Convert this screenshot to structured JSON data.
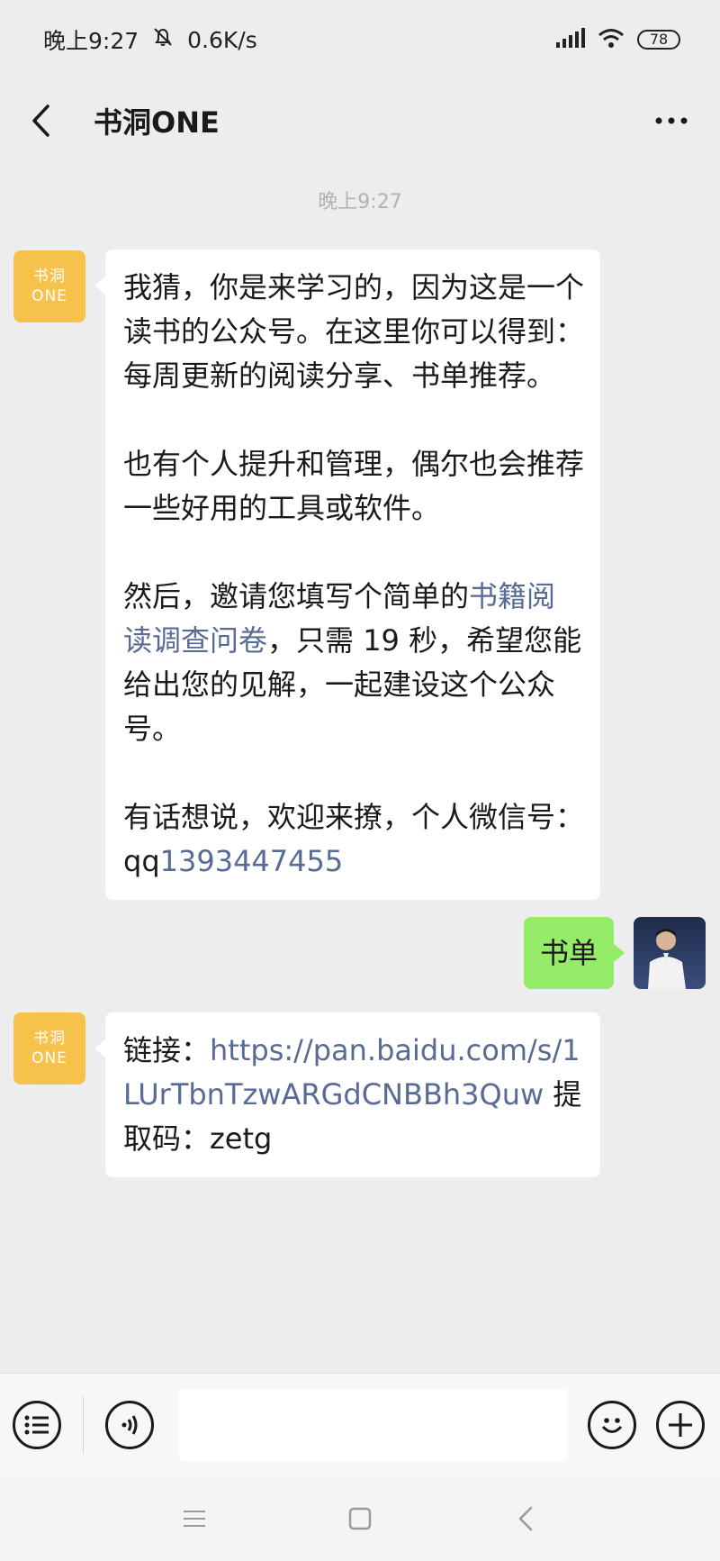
{
  "status_bar": {
    "time": "晚上9:27",
    "net_speed": "0.6K/s",
    "battery": "78",
    "icons": [
      "mute-bell-icon",
      "signal-icon",
      "wifi-icon",
      "battery-icon"
    ]
  },
  "header": {
    "title": "书洞ONE",
    "icons": [
      "back-arrow-icon",
      "more-icon"
    ]
  },
  "chat": {
    "timestamp": "晚上9:27",
    "bot_avatar_line1": "书洞",
    "bot_avatar_line2": "ONE",
    "message1": {
      "p1": "我猜，你是来学习的，因为这是一个读书的公众号。在这里你可以得到：每周更新的阅读分享、书单推荐。",
      "p2": "也有个人提升和管理，偶尔也会推荐一些好用的工具或软件。",
      "p3_before": "然后，邀请您填写个简单的",
      "p3_link": "书籍阅读调查问卷",
      "p3_after": "，只需 19 秒，希望您能给出您的见解，一起建设这个公众号。",
      "p4_text": "有话想说，欢迎来撩，个人微信号：qq",
      "p4_link": "1393447455"
    },
    "user_message": "书单",
    "message2": {
      "label": "链接：",
      "link": "https://pan.baidu.com/s/1LUrTbnTzwARGdCNBBh3Quw",
      "code_text": " 提取码：zetg"
    }
  },
  "input_bar": {
    "icons": [
      "menu-list-icon",
      "voice-icon",
      "emoji-icon",
      "plus-icon"
    ],
    "input_value": ""
  },
  "nav_bar": {
    "icons": [
      "nav-menu-icon",
      "nav-home-icon",
      "nav-back-icon"
    ]
  }
}
